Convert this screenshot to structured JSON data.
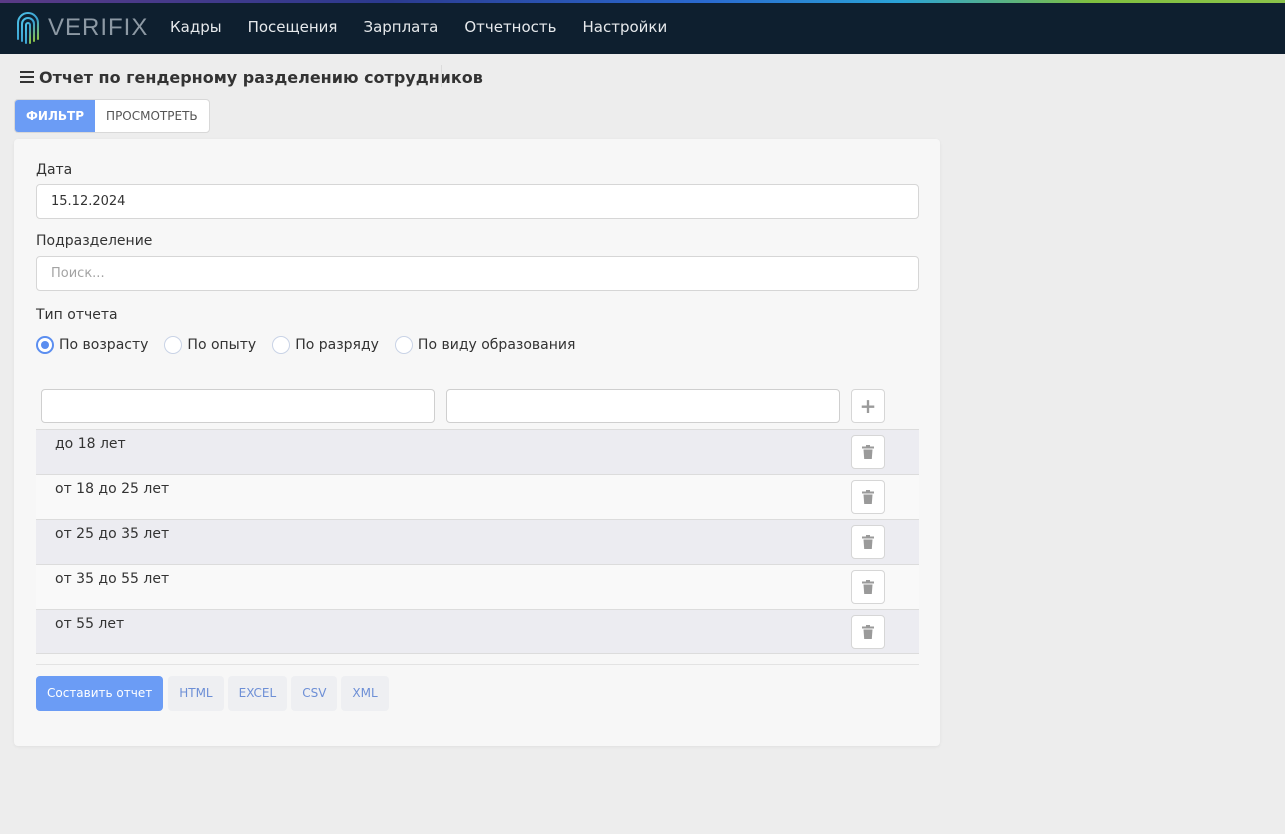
{
  "header": {
    "logo_text": "VERIFIX",
    "nav": [
      "Кадры",
      "Посещения",
      "Зарплата",
      "Отчетность",
      "Настройки"
    ]
  },
  "page": {
    "title": "Отчет по гендерному разделению сотрудников",
    "tabs": [
      {
        "label": "ФИЛЬТР",
        "active": true
      },
      {
        "label": "ПРОСМОТРЕТЬ",
        "active": false
      }
    ]
  },
  "form": {
    "date_label": "Дата",
    "date_value": "15.12.2024",
    "division_label": "Подразделение",
    "division_placeholder": "Поиск...",
    "report_type_label": "Тип отчета",
    "report_types": [
      {
        "label": "По возрасту",
        "checked": true
      },
      {
        "label": "По опыту",
        "checked": false
      },
      {
        "label": "По разряду",
        "checked": false
      },
      {
        "label": "По виду образования",
        "checked": false
      }
    ],
    "ranges": [
      "до 18 лет",
      "от 18 до 25 лет",
      "от 25 до 35 лет",
      "от 35 до 55 лет",
      "от 55 лет"
    ]
  },
  "actions": {
    "build": "Составить отчет",
    "formats": [
      "HTML",
      "EXCEL",
      "CSV",
      "XML"
    ]
  },
  "icons": {
    "menu": "hamburger-icon",
    "add": "plus-icon",
    "delete": "trash-icon",
    "logo": "fingerprint-icon"
  },
  "colors": {
    "topbar": "#0e1f2f",
    "accent": "#6b9cf5",
    "row_odd": "#ececf1"
  }
}
